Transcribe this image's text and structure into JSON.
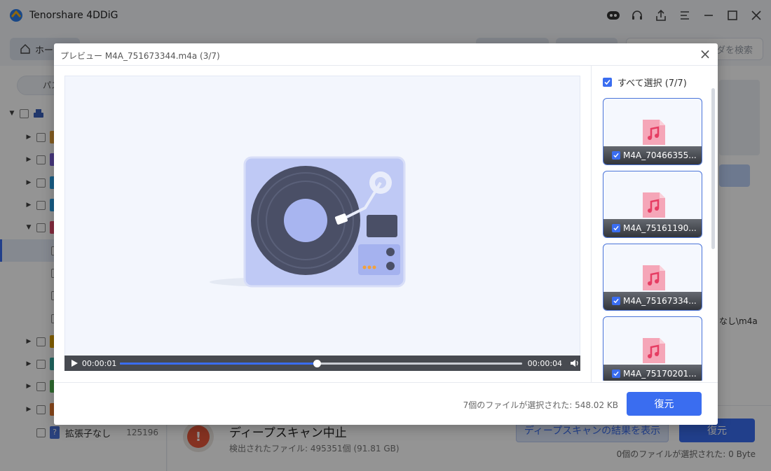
{
  "app": {
    "title": "Tenorshare 4DDiG",
    "home_tab": "ホー",
    "search_placeholder": "ダを検索",
    "path_pill": "パス",
    "path_tail": "なし\\m4a"
  },
  "sidebar": {
    "items": [
      {
        "name": "拡張子なし",
        "count": "125196",
        "icon_color": "#4a74d9"
      }
    ],
    "icon_colors": [
      "#e6a23c",
      "#7b5fd8",
      "#2aa3e8",
      "#2aa3e8",
      "#e64b6b",
      "#e2a400",
      "#38b0a6",
      "#52b752",
      "#ea7a30"
    ]
  },
  "bottom": {
    "scan_title": "ディープスキャン中止",
    "scan_detail": "検出されたファイル: 495351個 (91.81 GB)",
    "deep_scan_button": "ディープスキャンの結果を表示",
    "recover_button": "復元",
    "selected_info": "0個のファイルが選択された:  0 Byte"
  },
  "modal": {
    "title": "プレビュー M4A_751673344.m4a (3/7)",
    "select_all": "すべて選択 (7/7)",
    "player": {
      "current_time": "00:00:01",
      "end_time": "00:00:04",
      "progress": 0.49
    },
    "thumbnails": [
      {
        "name": "M4A_70466355..."
      },
      {
        "name": "M4A_75161190..."
      },
      {
        "name": "M4A_75167334..."
      },
      {
        "name": "M4A_75170201..."
      }
    ],
    "footer_info": "7個のファイルが選択された:  548.02 KB",
    "recover_button": "復元"
  },
  "colors": {
    "accent": "#3a6df0",
    "music_icon": "#f07a96"
  }
}
